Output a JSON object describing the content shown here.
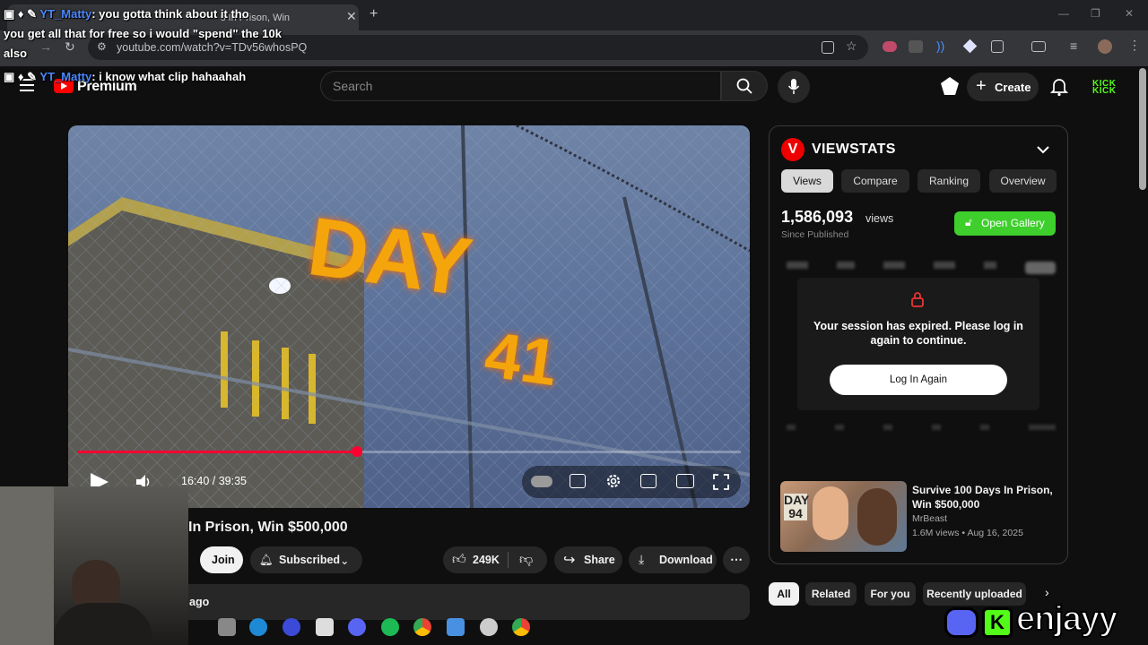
{
  "browser": {
    "tab_title": "s In Prison, Win",
    "url": "youtube.com/watch?v=TDv56whosPQ"
  },
  "youtube": {
    "logo_text": "Premium",
    "search_placeholder": "Search",
    "create_label": "Create",
    "kick_logo_line1": "KICK",
    "kick_logo_line2": "KICK"
  },
  "video": {
    "overlay_day": "DAY",
    "overlay_num": "41",
    "current_time": "16:40",
    "duration": "39:35",
    "time_display": "16:40 / 39:35",
    "progress_fraction": 0.421,
    "title_visible": "In Prison, Win $500,000",
    "join_label": "Join",
    "subscribed_label": "Subscribed",
    "likes_label": "249K",
    "share_label": "Share",
    "download_label": "Download",
    "description_snippet": "ago"
  },
  "viewstats": {
    "logo_letter": "V",
    "title": "VIEWSTATS",
    "tabs": [
      {
        "label": "Views",
        "active": true
      },
      {
        "label": "Compare",
        "active": false
      },
      {
        "label": "Ranking",
        "active": false
      },
      {
        "label": "Overview",
        "active": false
      }
    ],
    "view_count": "1,586,093",
    "view_unit": "views",
    "since_label": "Since Published",
    "gallery_label": "Open Gallery",
    "modal_message": "Your session has expired. Please log in again to continue.",
    "modal_button": "Log In Again",
    "accent_green": "#3ecf2c",
    "accent_red": "#e00000"
  },
  "recommended": {
    "title": "Survive 100 Days In Prison, Win $500,000",
    "channel": "MrBeast",
    "meta": "1.6M views • Aug 16, 2025",
    "thumb_text": "DAY 94"
  },
  "chips": [
    {
      "label": "All",
      "active": true
    },
    {
      "label": "Related",
      "active": false
    },
    {
      "label": "For you",
      "active": false
    },
    {
      "label": "Recently uploaded",
      "active": false
    }
  ],
  "chat": [
    {
      "name": "YT_Matty",
      "message": ": you gotta think about it tho"
    },
    {
      "name": "",
      "message": "you get all that for free so i would \"spend\" the 10k"
    },
    {
      "name": "",
      "message": "also"
    },
    {
      "name": "YT_Matty",
      "message": ": i know what clip hahaahah"
    }
  ],
  "watermark": {
    "text": "enjayy"
  }
}
